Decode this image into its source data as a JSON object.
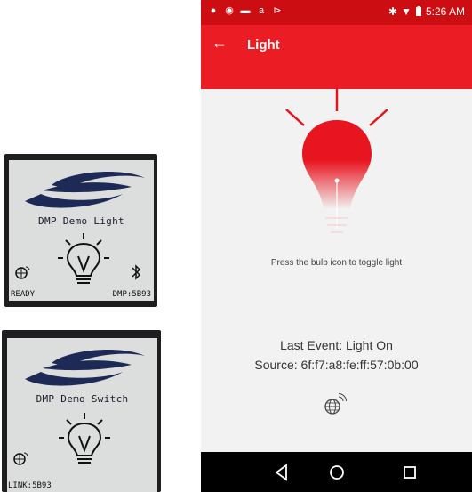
{
  "lcd_light": {
    "title": "DMP Demo Light",
    "status_left": "READY",
    "status_right": "DMP:5B93"
  },
  "lcd_switch": {
    "title": "DMP Demo Switch",
    "status_left": "LINK:5B93"
  },
  "statusbar": {
    "time": "5:26 AM"
  },
  "appbar": {
    "title": "Light"
  },
  "main": {
    "instruction": "Press the bulb icon to toggle light",
    "last_event_label": "Last Event:",
    "last_event_value": "Light On",
    "source_label": "Source:",
    "source_value": "6f:f7:a8:fe:ff:57:0b:00"
  },
  "colors": {
    "status_bar": "#cc0d12",
    "app_bar": "#ec1c24",
    "bulb": "#e8141f",
    "background": "#f2f2f2"
  },
  "icons": [
    "back-arrow-icon",
    "bulb-icon",
    "network-icon",
    "back-nav-icon",
    "home-nav-icon",
    "recents-nav-icon",
    "bluetooth-icon",
    "wifi-icon",
    "battery-icon"
  ]
}
